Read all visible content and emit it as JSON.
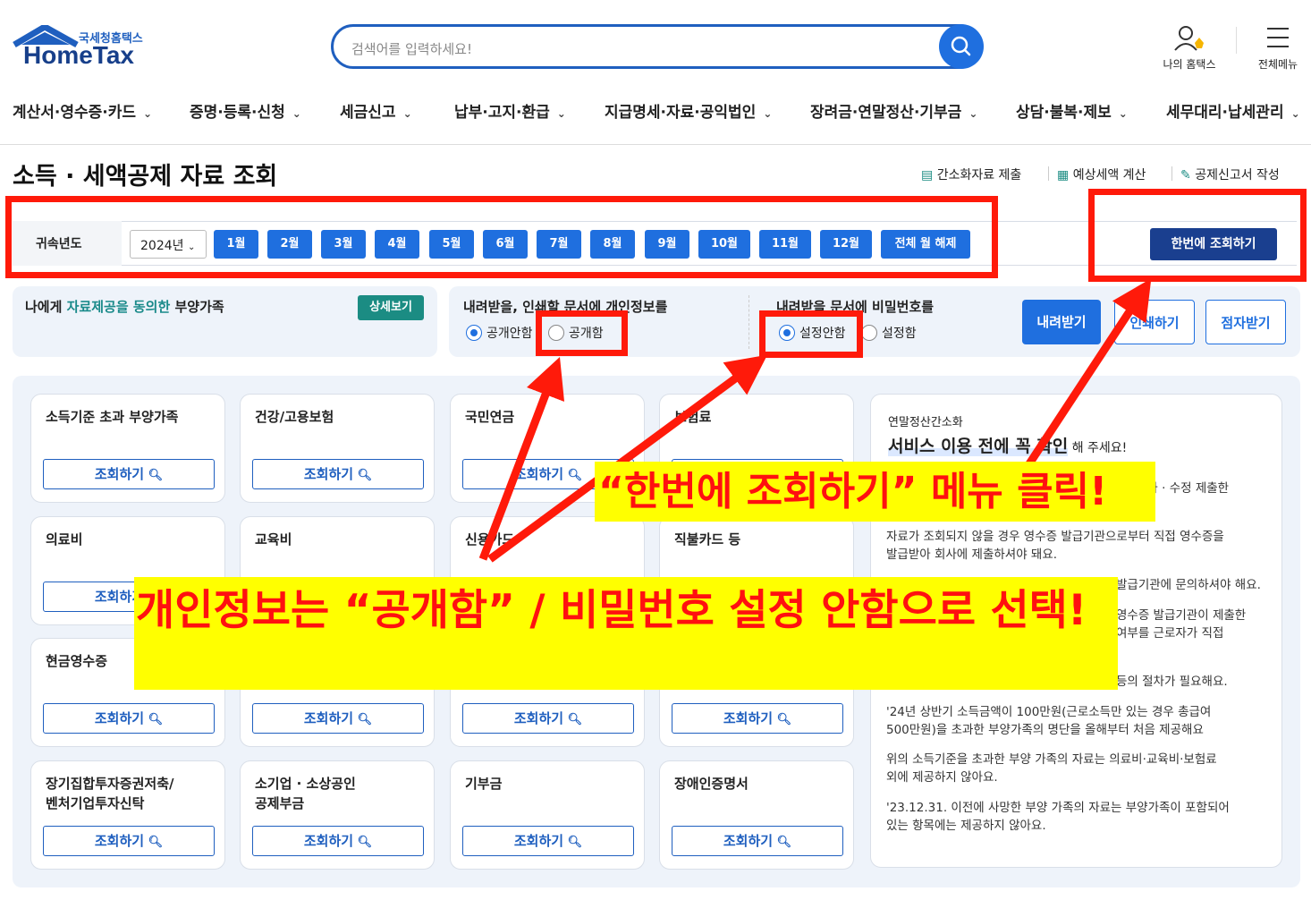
{
  "header": {
    "logo_small": "국세청홈택스",
    "logo_big": "HomeTax",
    "search_placeholder": "검색어를 입력하세요!",
    "my_hometax": "나의 홈택스",
    "all_menu": "전체메뉴"
  },
  "gnb": [
    "계산서·영수증·카드",
    "증명·등록·신청",
    "세금신고",
    "납부·고지·환급",
    "지급명세·자료·공익법인",
    "장려금·연말정산·기부금",
    "상담·불복·제보",
    "세무대리·납세관리"
  ],
  "page": {
    "title": "소득 · 세액공제 자료 조회",
    "links": [
      "간소화자료 제출",
      "예상세액 계산",
      "공제신고서 작성"
    ]
  },
  "yearbar": {
    "label": "귀속년도",
    "year": "2024년",
    "months": [
      "1월",
      "2월",
      "3월",
      "4월",
      "5월",
      "6월",
      "7월",
      "8월",
      "9월",
      "10월",
      "11월",
      "12월"
    ],
    "clear_all": "전체 월 해제",
    "query_all": "한번에 조회하기"
  },
  "options": {
    "dependents_prefix": "나에게 ",
    "dependents_highlight": "자료제공을 동의한",
    "dependents_suffix": " 부양가족",
    "detail_button": "상세보기",
    "privacy_label": "내려받을, 인쇄할 문서에 개인정보를",
    "privacy_options": [
      "공개안함",
      "공개함"
    ],
    "password_label": "내려받을 문서에 비밀번호를",
    "password_options": [
      "설정안함",
      "설정함"
    ],
    "download": "내려받기",
    "print": "인쇄하기",
    "braille": "점자받기"
  },
  "cards": [
    "소득기준 초과 부양가족",
    "건강/고용보험",
    "국민연금",
    "보험료",
    "의료비",
    "교육비",
    "신용카드",
    "직불카드 등",
    "현금영수증",
    "",
    "",
    "",
    "장기집합투자증권저축/\n벤처기업투자신탁",
    "소기업 · 소상공인\n공제부금",
    "기부금",
    "장애인증명서"
  ],
  "card_button": "조회하기",
  "info": {
    "subtitle": "연말정산간소화",
    "title_main": "서비스 이용 전에 꼭 확인",
    "title_suffix": " 해 주세요!",
    "items": [
      "추가 · 수정 제출한",
      "자료가 조회되지 않을 경우 영수증 발급기관으로부터 직접 영수증을\n발급받아 회사에 제출하셔야 돼요.",
      "발급기관에 문의하셔야 해요.",
      "영수증 발급기관이 제출한\n여부를 근로자가 직접",
      "등의 절차가 필요해요.",
      "'24년 상반기 소득금액이 100만원(근로소득만 있는 경우 총급여\n500만원)을 초과한 부양가족의 명단을 올해부터 처음 제공해요",
      "위의 소득기준을 초과한 부양 가족의 자료는 의료비·교육비·보험료\n외에 제공하지 않아요.",
      "'23.12.31. 이전에 사망한 부양 가족의 자료는 부양가족이 포함되어\n있는 항목에는 제공하지 않아요."
    ]
  },
  "annotations": {
    "callout_top": "“한번에 조회하기” 메뉴 클릭!",
    "callout_bottom": "개인정보는 “공개함” / 비밀번호 설정 안함으로 선택!"
  },
  "colors": {
    "primary": "#1f6fdf",
    "navy": "#1a3f8f",
    "teal": "#1b8c83",
    "annotation_red": "#ff1a0a",
    "annotation_yellow": "#ffff00"
  }
}
